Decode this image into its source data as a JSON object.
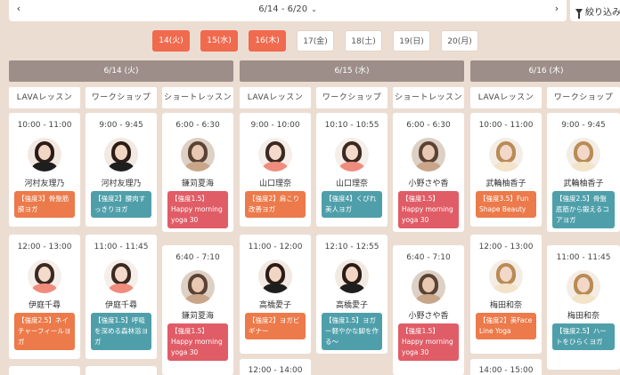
{
  "nav": {
    "prev_icon": "‹",
    "next_icon": "›",
    "range": "6/14 - 6/20",
    "range_caret": "⌄",
    "filter_label": "絞り込み"
  },
  "day_tabs": [
    {
      "label": "14(火)",
      "active": true
    },
    {
      "label": "15(水)",
      "active": true
    },
    {
      "label": "16(木)",
      "active": true
    },
    {
      "label": "17(金)",
      "active": false
    },
    {
      "label": "18(土)",
      "active": false
    },
    {
      "label": "19(日)",
      "active": false
    },
    {
      "label": "20(月)",
      "active": false
    }
  ],
  "day_columns": [
    {
      "date": "6/14 (火)"
    },
    {
      "date": "6/15 (水)"
    },
    {
      "date": "6/16 (木)"
    }
  ],
  "lesson_types": [
    "LAVAレッスン",
    "ワークショップ",
    "ショートレッスン",
    "LAVAレッスン",
    "ワークショップ",
    "ショートレッスン",
    "LAVAレッスン",
    "ワークショップ"
  ],
  "lessons": [
    {
      "time": "10:00 - 11:00",
      "name": "河村友理乃",
      "tag": "【強度3】骨盤筋膜ヨガ",
      "tag_color": "orange"
    },
    {
      "time": "9:00 - 9:45",
      "name": "河村友理乃",
      "tag": "【強度2】腰肉すっきりヨガ",
      "tag_color": "teal"
    },
    {
      "time": "6:00 - 6:30",
      "name": "鎌苅夏海",
      "tag": "【強度1.5】Happy morning yoga 30",
      "tag_color": "red"
    },
    {
      "time": "9:00 - 10:00",
      "name": "山口理奈",
      "tag": "【強度2】肩こり改善ヨガ",
      "tag_color": "orange"
    },
    {
      "time": "10:10 - 10:55",
      "name": "山口理奈",
      "tag": "【強度4】くびれ美人ヨガ",
      "tag_color": "teal"
    },
    {
      "time": "6:00 - 6:30",
      "name": "小野さや香",
      "tag": "【強度1.5】Happy morning yoga 30",
      "tag_color": "red"
    },
    {
      "time": "10:00 - 11:00",
      "name": "武輪柚香子",
      "tag": "【強度3.5】Fun Shape Beauty",
      "tag_color": "orange"
    },
    {
      "time": "9:00 - 9:45",
      "name": "武輪柚香子",
      "tag": "【強度2.5】骨盤底筋から鍛えるコアヨガ",
      "tag_color": "teal"
    },
    {
      "time": "12:00 - 13:00",
      "name": "伊庭千尋",
      "tag": "【強度2.5】ネイチャーフィールヨガ",
      "tag_color": "orange"
    },
    {
      "time": "11:00 - 11:45",
      "name": "伊庭千尋",
      "tag": "【強度1.5】呼吸を深める森林浴ヨガ",
      "tag_color": "teal"
    },
    {
      "time": "6:40 - 7:10",
      "name": "鎌苅夏海",
      "tag": "【強度1.5】Happy morning yoga 30",
      "tag_color": "red"
    },
    {
      "time": "11:00 - 12:00",
      "name": "高橋愛子",
      "tag": "【強度2】ヨガビギナー",
      "tag_color": "orange"
    },
    {
      "time": "12:10 - 12:55",
      "name": "高橋愛子",
      "tag": "【強度1.5】ヨガー軽やかな脚を作る〜",
      "tag_color": "teal"
    },
    {
      "time": "6:40 - 7:10",
      "name": "小野さや香",
      "tag": "【強度1.5】Happy morning yoga 30",
      "tag_color": "red"
    },
    {
      "time": "12:00 - 13:00",
      "name": "梅田和奈",
      "tag": "【強度2】美Face Line Yoga",
      "tag_color": "orange"
    },
    {
      "time": "11:00 - 11:45",
      "name": "梅田和奈",
      "tag": "【強度2.5】ハートをひらくヨガ",
      "tag_color": "teal"
    }
  ],
  "partial_times": [
    "12:00 - 14:00",
    "14:00 - 15:00"
  ]
}
